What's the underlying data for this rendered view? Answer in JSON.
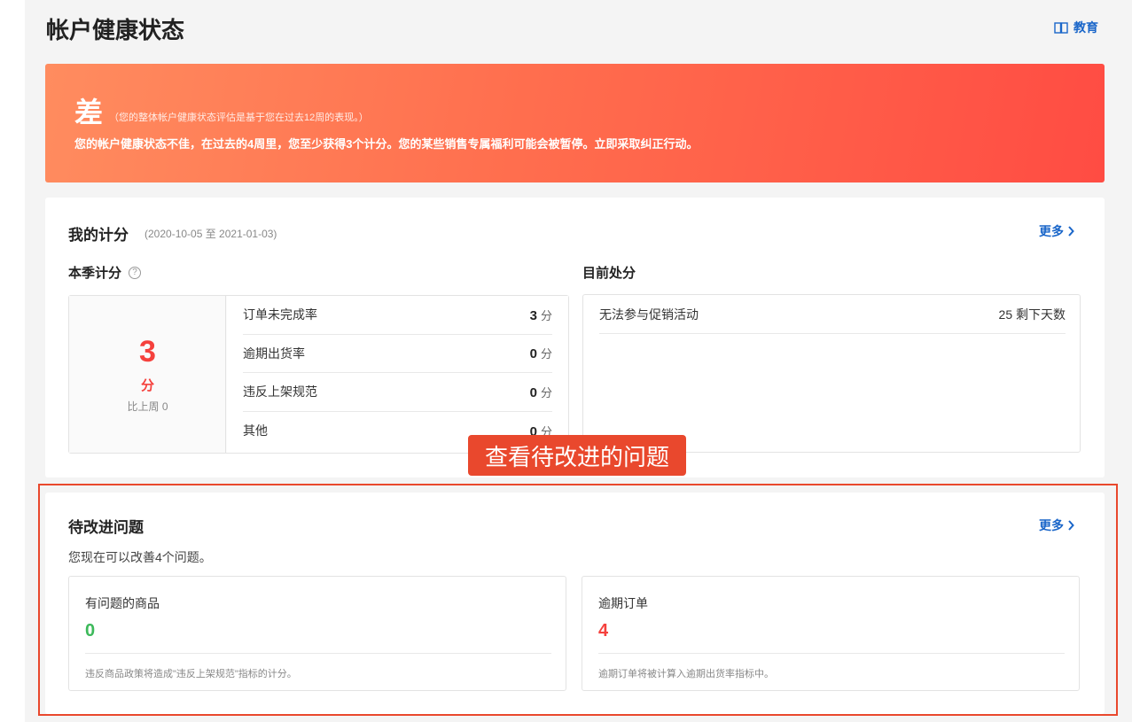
{
  "header": {
    "title": "帐户健康状态",
    "education_label": "教育"
  },
  "banner": {
    "grade": "差",
    "note": "（您的整体帐户健康状态评估是基于您在过去12周的表现。）",
    "message": "您的帐户健康状态不佳，在过去的4周里，您至少获得3个计分。您的某些销售专属福利可能会被暂停。立即采取纠正行动。"
  },
  "score_card": {
    "title": "我的计分",
    "range": "(2020-10-05 至 2021-01-03)",
    "more_label": "更多",
    "season_title": "本季计分",
    "total_score": "3",
    "total_unit": "分",
    "compare": "比上周 0",
    "rows": [
      {
        "label": "订单未完成率",
        "value": "3",
        "unit": "分"
      },
      {
        "label": "逾期出货率",
        "value": "0",
        "unit": "分"
      },
      {
        "label": "违反上架规范",
        "value": "0",
        "unit": "分"
      },
      {
        "label": "其他",
        "value": "0",
        "unit": "分"
      }
    ],
    "penalty_title": "目前处分",
    "penalty": {
      "label": "无法参与促销活动",
      "value": "25 剩下天数"
    }
  },
  "tooltip": "查看待改进的问题",
  "issues_card": {
    "title": "待改进问题",
    "more_label": "更多",
    "description": "您现在可以改善4个问题。",
    "items": [
      {
        "name": "有问题的商品",
        "count": "0",
        "note": "违反商品政策将造成\"违反上架规范\"指标的计分。"
      },
      {
        "name": "逾期订单",
        "count": "4",
        "note": "逾期订单将被计算入逾期出货率指标中。"
      }
    ]
  },
  "colors": {
    "accent_blue": "#1a66c9",
    "alert_red": "#f5413d",
    "good_green": "#3cb95a",
    "highlight": "#e9482d"
  }
}
